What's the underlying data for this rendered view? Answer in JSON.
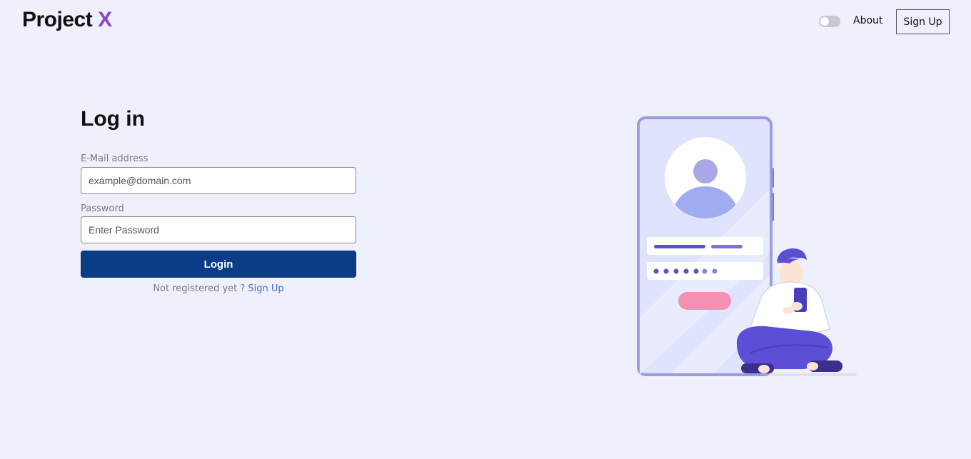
{
  "header": {
    "logo_main": "Project",
    "logo_accent": "X",
    "about_link": "About",
    "signup_button": "Sign Up"
  },
  "login": {
    "title": "Log in",
    "email_label": "E-Mail address",
    "email_placeholder": "example@domain.com",
    "password_label": "Password",
    "password_placeholder": "Enter Password",
    "submit_label": "Login",
    "register_prompt": "Not registered yet ?",
    "register_link": "Sign Up"
  },
  "theme": {
    "background": "#eef0fb",
    "primary_button": "#0b3c86",
    "logo_accent": "#8e44c6",
    "link": "#3f6fd0"
  }
}
